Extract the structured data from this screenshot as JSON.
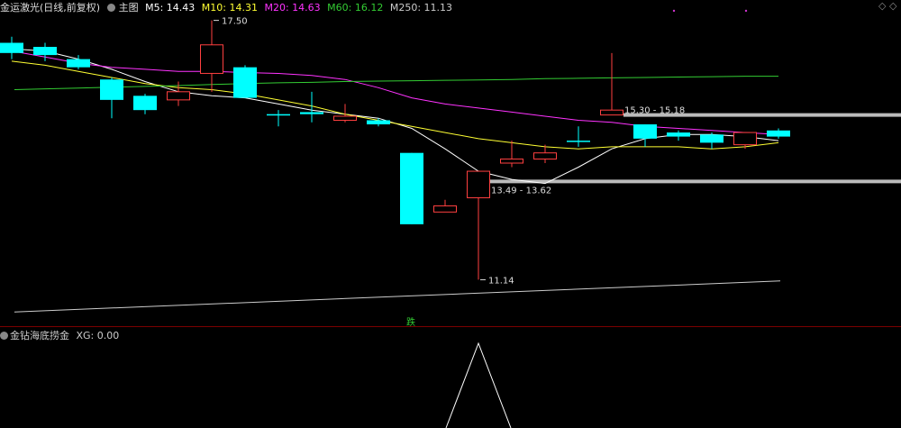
{
  "header": {
    "stock_title": "金运激光(日线,前复权)",
    "main_label": "主图",
    "m5": "M5: 14.43",
    "m10": "M10: 14.31",
    "m20": "M20: 14.63",
    "m60": "M60: 16.12",
    "m250": "M250: 11.13",
    "colors": {
      "m5": "#ffffff",
      "m10": "#ffff33",
      "m20": "#ff33ff",
      "m60": "#33cc33",
      "m250": "#cccccc"
    }
  },
  "indicator": {
    "name": "金钻海底捞金",
    "value": "XG: 0.00",
    "signal_label": "跌"
  },
  "annotations": {
    "high": "17.50",
    "low": "11.14",
    "level1": "15.30 - 15.18",
    "level2": "13.49 - 13.62"
  },
  "colors": {
    "up": "#ff4040",
    "down": "#00ffff",
    "background": "#000000"
  },
  "chart_data": {
    "type": "candlestick",
    "ohlc": [
      {
        "o": 16.95,
        "h": 17.1,
        "c": 16.7,
        "l": 16.55
      },
      {
        "o": 16.85,
        "h": 16.95,
        "c": 16.65,
        "l": 16.5
      },
      {
        "o": 16.55,
        "h": 16.65,
        "c": 16.35,
        "l": 16.3
      },
      {
        "o": 16.05,
        "h": 16.1,
        "c": 15.55,
        "l": 15.1
      },
      {
        "o": 15.65,
        "h": 15.7,
        "c": 15.3,
        "l": 15.2
      },
      {
        "o": 15.55,
        "h": 16.0,
        "c": 15.75,
        "l": 15.4
      },
      {
        "o": 16.2,
        "h": 17.5,
        "c": 16.9,
        "l": 15.75
      },
      {
        "o": 16.35,
        "h": 16.4,
        "c": 15.6,
        "l": 15.6
      },
      {
        "o": 15.2,
        "h": 15.3,
        "c": 15.2,
        "l": 14.9
      },
      {
        "o": 15.25,
        "h": 15.75,
        "c": 15.2,
        "l": 15.0
      },
      {
        "o": 15.05,
        "h": 15.45,
        "c": 15.15,
        "l": 15.0
      },
      {
        "o": 15.05,
        "h": 15.1,
        "c": 14.95,
        "l": 14.9
      },
      {
        "o": 14.25,
        "h": 14.25,
        "c": 12.5,
        "l": 12.5
      },
      {
        "o": 12.8,
        "h": 13.1,
        "c": 12.95,
        "l": 12.8
      },
      {
        "o": 13.15,
        "h": 13.5,
        "c": 13.8,
        "l": 11.14
      },
      {
        "o": 14.0,
        "h": 14.55,
        "c": 14.1,
        "l": 13.9
      },
      {
        "o": 14.1,
        "h": 14.45,
        "c": 14.25,
        "l": 14.0
      },
      {
        "o": 14.55,
        "h": 14.9,
        "c": 14.55,
        "l": 14.4
      },
      {
        "o": 15.18,
        "h": 16.7,
        "c": 15.3,
        "l": 15.18
      },
      {
        "o": 14.95,
        "h": 14.95,
        "c": 14.6,
        "l": 14.4
      },
      {
        "o": 14.75,
        "h": 14.8,
        "c": 14.65,
        "l": 14.55
      },
      {
        "o": 14.7,
        "h": 14.75,
        "c": 14.5,
        "l": 14.35
      },
      {
        "o": 14.45,
        "h": 14.75,
        "c": 14.75,
        "l": 14.35
      },
      {
        "o": 14.8,
        "h": 14.85,
        "c": 14.65,
        "l": 14.6
      }
    ],
    "ma": {
      "M5": [
        16.8,
        16.75,
        16.55,
        16.3,
        16.0,
        15.75,
        15.65,
        15.6,
        15.45,
        15.3,
        15.2,
        15.1,
        14.85,
        14.35,
        13.8,
        13.6,
        13.5,
        13.9,
        14.35,
        14.6,
        14.7,
        14.7,
        14.65,
        14.55
      ],
      "M10": [
        16.5,
        16.4,
        16.25,
        16.1,
        15.95,
        15.85,
        15.8,
        15.7,
        15.55,
        15.4,
        15.2,
        15.05,
        14.9,
        14.75,
        14.6,
        14.5,
        14.4,
        14.35,
        14.4,
        14.4,
        14.4,
        14.35,
        14.4,
        14.5
      ],
      "M20": [
        16.75,
        16.6,
        16.45,
        16.35,
        16.3,
        16.25,
        16.25,
        16.22,
        16.2,
        16.15,
        16.05,
        15.85,
        15.6,
        15.45,
        15.35,
        15.25,
        15.15,
        15.05,
        15.0,
        14.9,
        14.85,
        14.8,
        14.75,
        14.7
      ],
      "M60": [
        15.8,
        15.82,
        15.84,
        15.86,
        15.88,
        15.9,
        15.93,
        15.95,
        15.97,
        15.98,
        16.0,
        16.01,
        16.02,
        16.03,
        16.04,
        16.05,
        16.07,
        16.08,
        16.09,
        16.1,
        16.11,
        16.12,
        16.13,
        16.13
      ],
      "M250": [
        10.35,
        10.4,
        10.45,
        10.5,
        10.55,
        10.58,
        10.61,
        10.64,
        10.67,
        10.7,
        10.72,
        10.75,
        10.78,
        10.81,
        10.84,
        10.87,
        10.9,
        10.93,
        10.96,
        10.99,
        11.02,
        11.05,
        11.08,
        11.11
      ]
    },
    "levels": [
      {
        "label": "15.30 - 15.18",
        "value": 15.18
      },
      {
        "label": "13.49 - 13.62",
        "value": 13.55
      }
    ],
    "indicator_peak_index": 14
  }
}
